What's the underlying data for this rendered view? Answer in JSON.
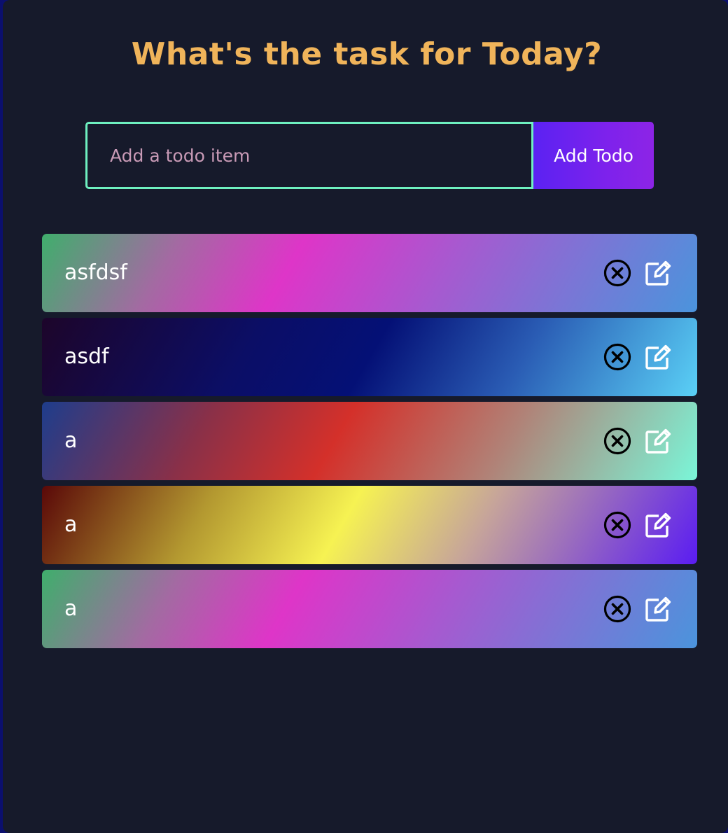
{
  "header": {
    "title": "What's the task for Today?"
  },
  "form": {
    "placeholder": "Add a todo item",
    "value": "",
    "button_label": "Add Todo"
  },
  "todos": [
    {
      "text": "asfdsf"
    },
    {
      "text": "asdf"
    },
    {
      "text": "a"
    },
    {
      "text": "a"
    },
    {
      "text": "a"
    }
  ],
  "icons": {
    "delete": "circle-x-icon",
    "edit": "pencil-square-icon"
  },
  "colors": {
    "title": "#f0b45a",
    "background": "#161a2b",
    "input_border": "#6ef0c0",
    "button": "#7d22ec"
  }
}
